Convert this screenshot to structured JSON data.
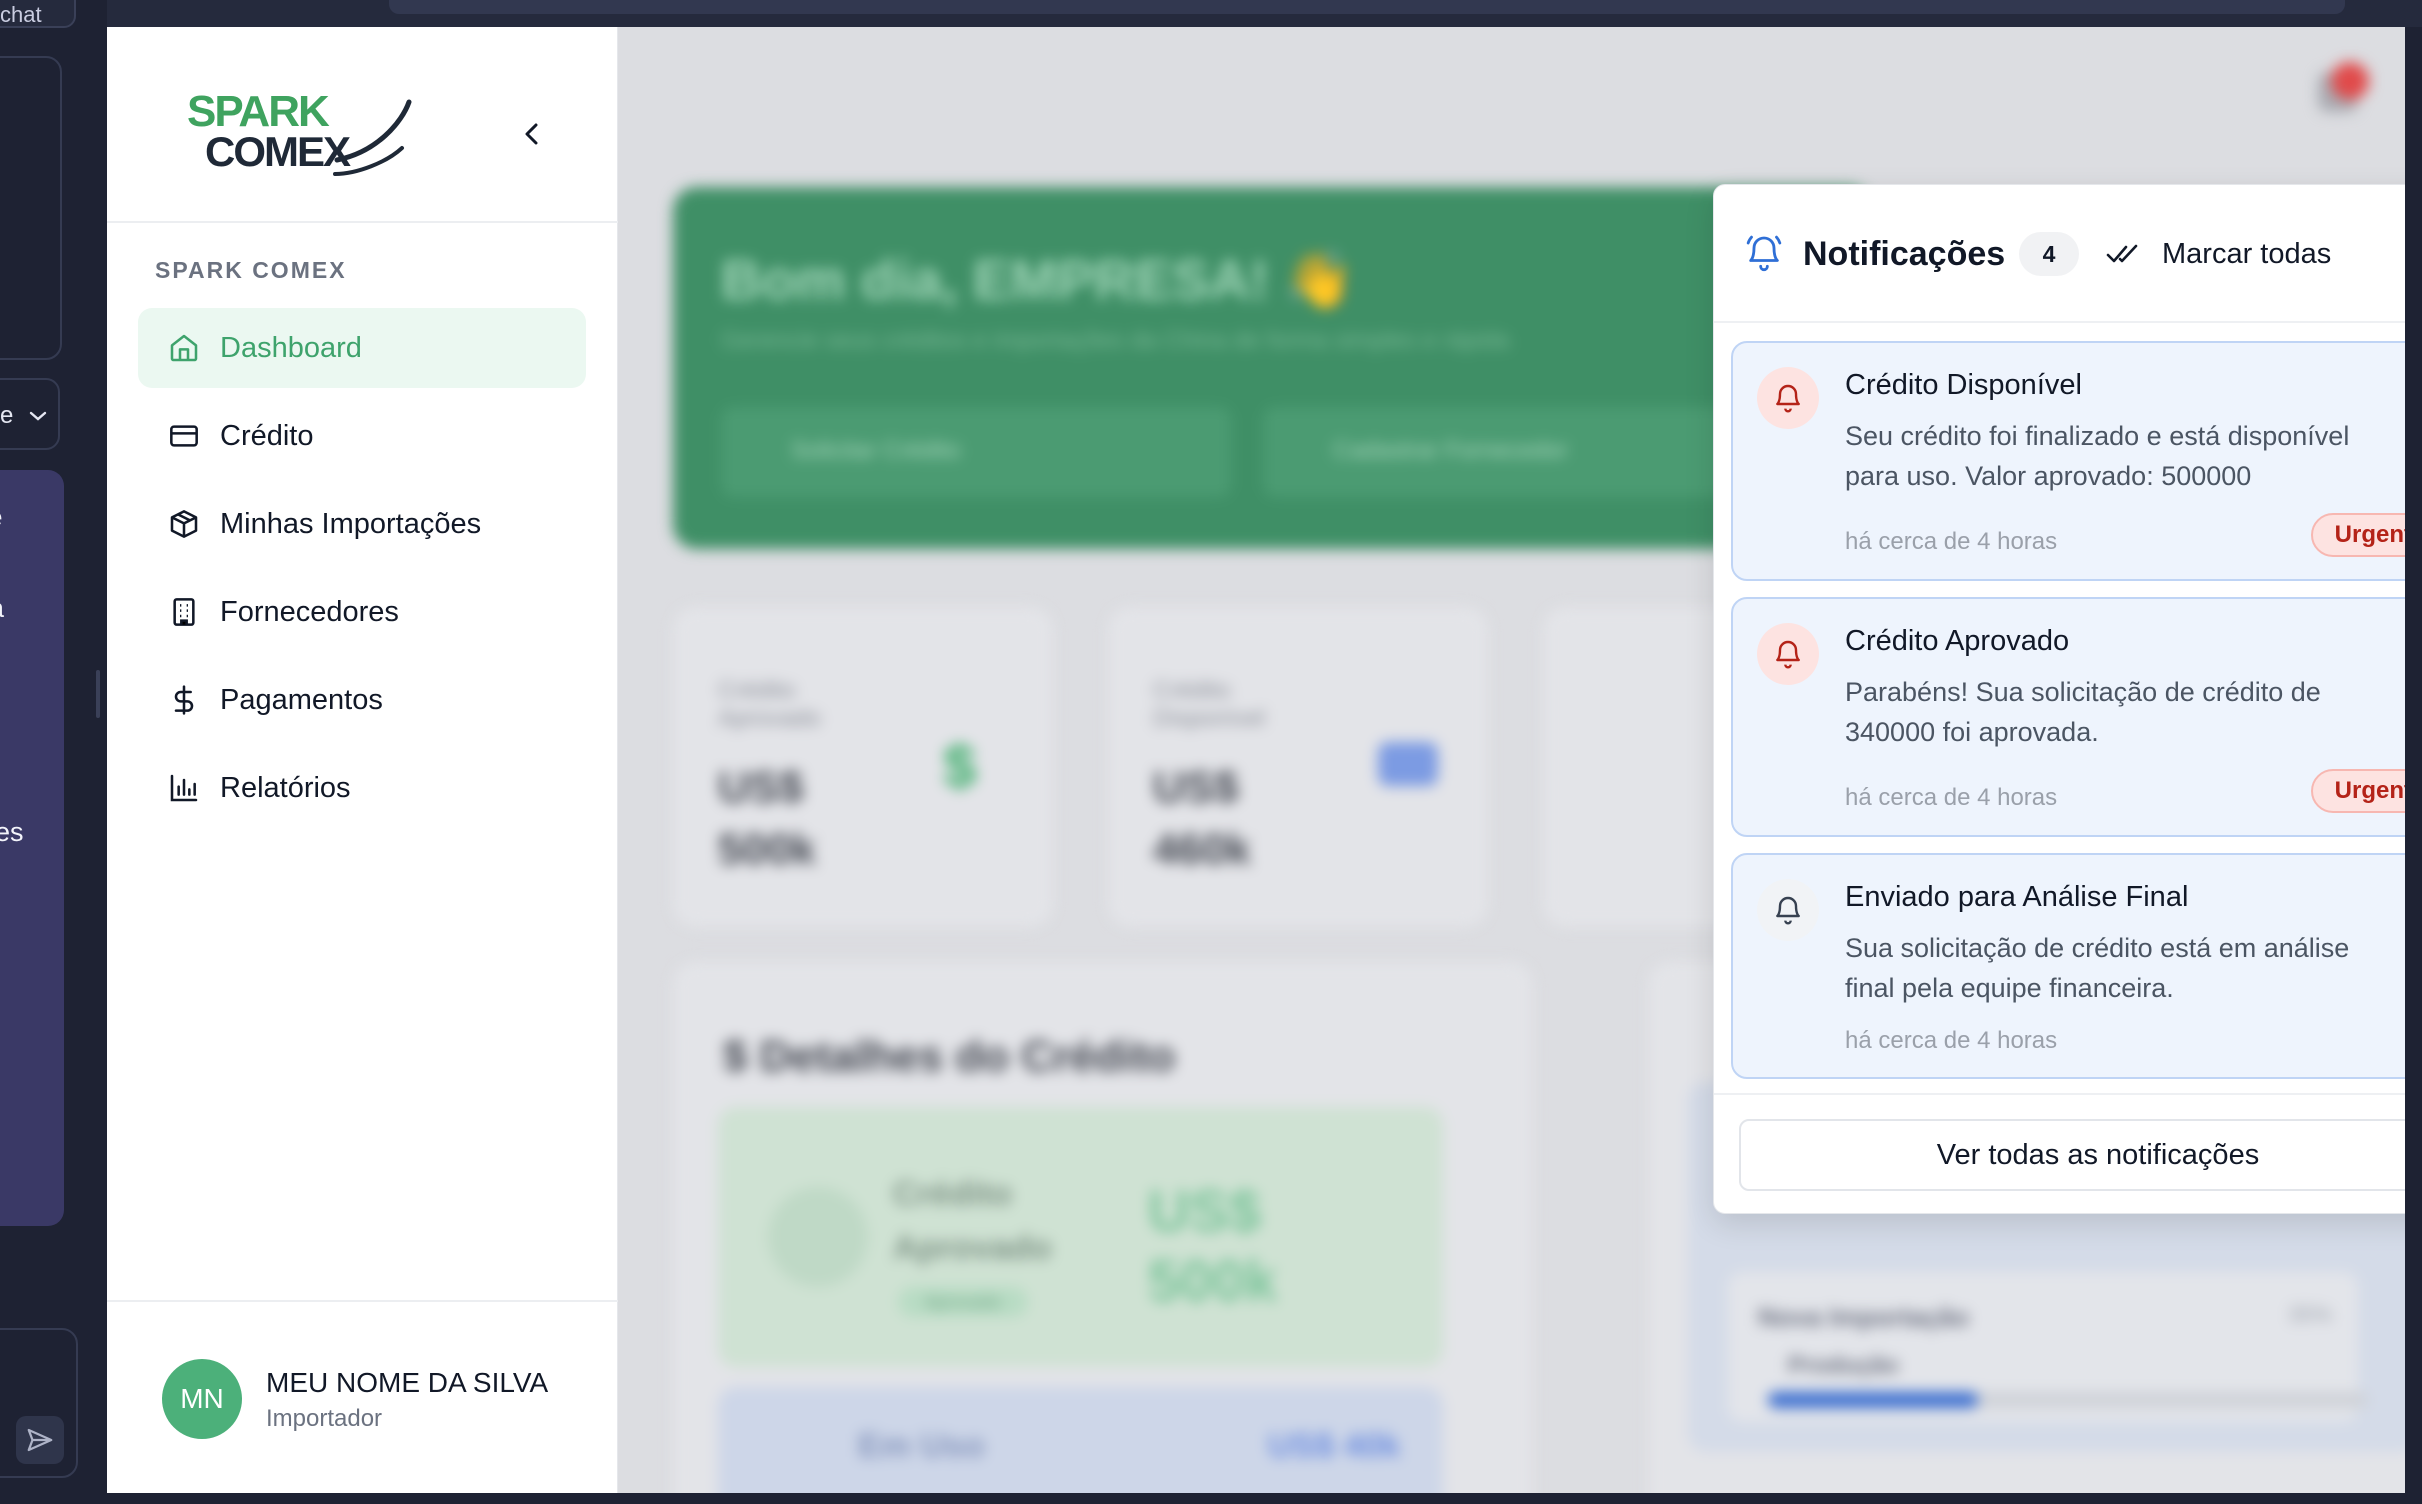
{
  "chat_strip": {
    "top_chip": "chat",
    "select_text": "e",
    "snippets": [
      "te",
      "ra",
      "ões",
      "a"
    ]
  },
  "sidebar": {
    "brand_top": "SPARK",
    "brand_bottom": "COMEX",
    "section_label": "SPARK COMEX",
    "items": [
      {
        "label": "Dashboard",
        "icon": "home-icon",
        "active": true
      },
      {
        "label": "Crédito",
        "icon": "credit-card-icon",
        "active": false
      },
      {
        "label": "Minhas Importações",
        "icon": "package-icon",
        "active": false
      },
      {
        "label": "Fornecedores",
        "icon": "building-icon",
        "active": false
      },
      {
        "label": "Pagamentos",
        "icon": "dollar-icon",
        "active": false
      },
      {
        "label": "Relatórios",
        "icon": "bar-chart-icon",
        "active": false
      }
    ],
    "user": {
      "initials": "MN",
      "name": "MEU NOME DA SILVA",
      "role": "Importador"
    }
  },
  "background": {
    "greeting": "Bom dia, EMPRESA! 👋",
    "greeting_sub": "Gerencie seus créditos e importações da China de forma simples e rápida",
    "hero_buttons": [
      "Solicitar Crédito",
      "Cadastrar Fornecedor"
    ],
    "stats": [
      {
        "label": "Crédito Aprovado",
        "value": "US$ 500k"
      },
      {
        "label": "Crédito Disponível",
        "value": "US$ 460k"
      }
    ],
    "details_title": "$ Detalhes do Crédito",
    "details_label": "Crédito Aprovado",
    "details_value": "US$ 500k",
    "details_tag": "Aprovado",
    "in_use_label": "Em Uso",
    "in_use_value": "US$ 40k",
    "import_label": "Nova Importação",
    "import_status": "Produção",
    "import_percent": "35%",
    "import_progress": 0.35
  },
  "notifications": {
    "title": "Notificações",
    "count": "4",
    "mark_all_label": "Marcar todas",
    "items": [
      {
        "title": "Crédito Disponível",
        "body": "Seu crédito foi finalizado e está disponível para uso. Valor aprovado: 500000",
        "time": "há cerca de 4 horas",
        "badge": "Urgente",
        "urgent": true,
        "unread": true
      },
      {
        "title": "Crédito Aprovado",
        "body": "Parabéns! Sua solicitação de crédito de 340000 foi aprovada.",
        "time": "há cerca de 4 horas",
        "badge": "Urgente",
        "urgent": true,
        "unread": true
      },
      {
        "title": "Enviado para Análise Final",
        "body": "Sua solicitação de crédito está em análise final pela equipe financeira.",
        "time": "há cerca de 4 horas",
        "badge": "",
        "urgent": false,
        "unread": true
      }
    ],
    "view_all_label": "Ver todas as notificações"
  },
  "colors": {
    "brand_green": "#3ea36c",
    "urgent_red": "#b42318",
    "unread_blue": "#3b7ae0",
    "chat_panel": "#3a3966"
  }
}
